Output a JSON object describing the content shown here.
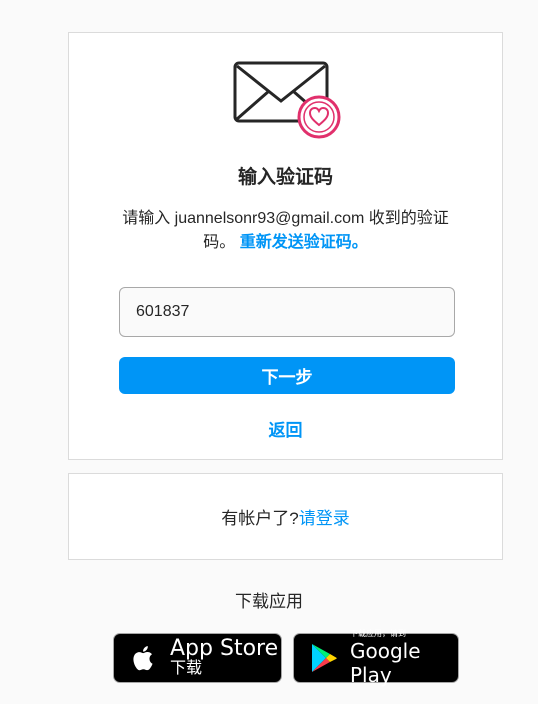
{
  "verify": {
    "title": "输入验证码",
    "desc_prefix": "请输入 juannelsonr93@gmail.com 收到的验证码。",
    "resend_label": "重新发送验证码。",
    "code_value": "601837",
    "next_label": "下一步",
    "back_label": "返回"
  },
  "login_prompt": {
    "text": "有帐户了?",
    "link_label": "请登录"
  },
  "get_app": {
    "label": "下载应用",
    "app_store": {
      "line1": "App Store",
      "line2": "下载"
    },
    "google_play": {
      "line1": "下载应用，请到",
      "line2": "Google Play"
    }
  },
  "colors": {
    "accent": "#0095f6",
    "badge_heart": "#e1306c"
  },
  "icons": [
    "envelope-icon",
    "heart-badge-icon",
    "apple-logo-icon",
    "google-play-logo-icon"
  ]
}
